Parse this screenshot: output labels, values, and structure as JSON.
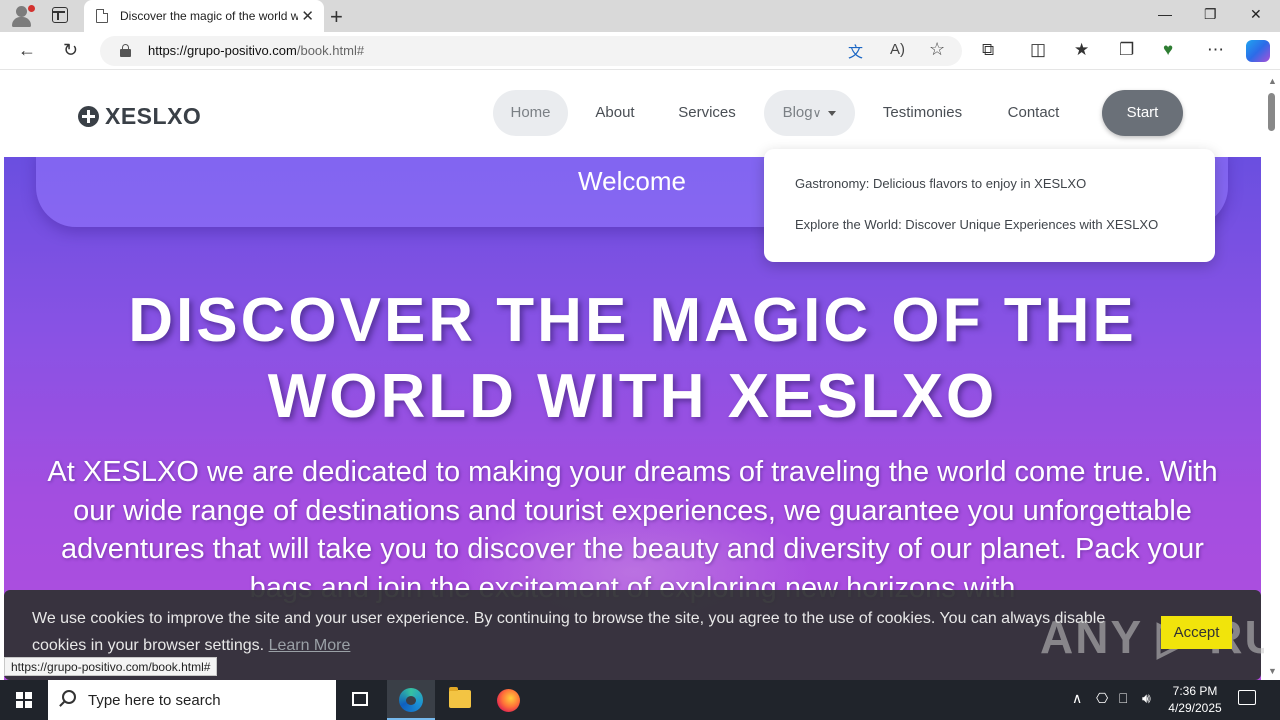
{
  "browser": {
    "tab_title": "Discover the magic of the world with XESLXO",
    "tab_close": "✕",
    "new_tab": "+",
    "url_host": "https://grupo-positivo.com",
    "url_path": "/book.html#",
    "window": {
      "minimize": "—",
      "maximize": "❐",
      "close": "✕"
    }
  },
  "site": {
    "logo": "XESLXO",
    "nav": [
      {
        "label": "Home"
      },
      {
        "label": "About"
      },
      {
        "label": "Services"
      },
      {
        "label": "Blog"
      },
      {
        "label": "Testimonies"
      },
      {
        "label": "Contact"
      }
    ],
    "start_button": "Start",
    "blog_dropdown": [
      "Gastronomy: Delicious flavors to enjoy in XESLXO",
      "Explore the World: Discover Unique Experiences with XESLXO"
    ],
    "welcome": "Welcome",
    "hero_title": "DISCOVER THE MAGIC OF THE WORLD WITH XESLXO",
    "hero_text": "At XESLXO we are dedicated to making your dreams of traveling the world come true. With our wide range of destinations and tourist experiences, we guarantee you unforgettable adventures that will take you to discover the beauty and diversity of our planet. Pack your bags and join the excitement of exploring new horizons with"
  },
  "cookie": {
    "text": "We use cookies to improve the site and your user experience. By continuing to browse the site, you agree to the use of cookies. You can always disable cookies in your browser settings.",
    "learn_more": "Learn More",
    "accept": "Accept",
    "watermark": "ANY ▷ RUN"
  },
  "status_bar_url": "https://grupo-positivo.com/book.html#",
  "taskbar": {
    "search_placeholder": "Type here to search",
    "time": "7:36 PM",
    "date": "4/29/2025"
  },
  "colors": {
    "hero_top": "#6a4fe0",
    "hero_bottom": "#b14dde",
    "accept_button": "#f1e40b",
    "start_button": "#6a7078"
  }
}
